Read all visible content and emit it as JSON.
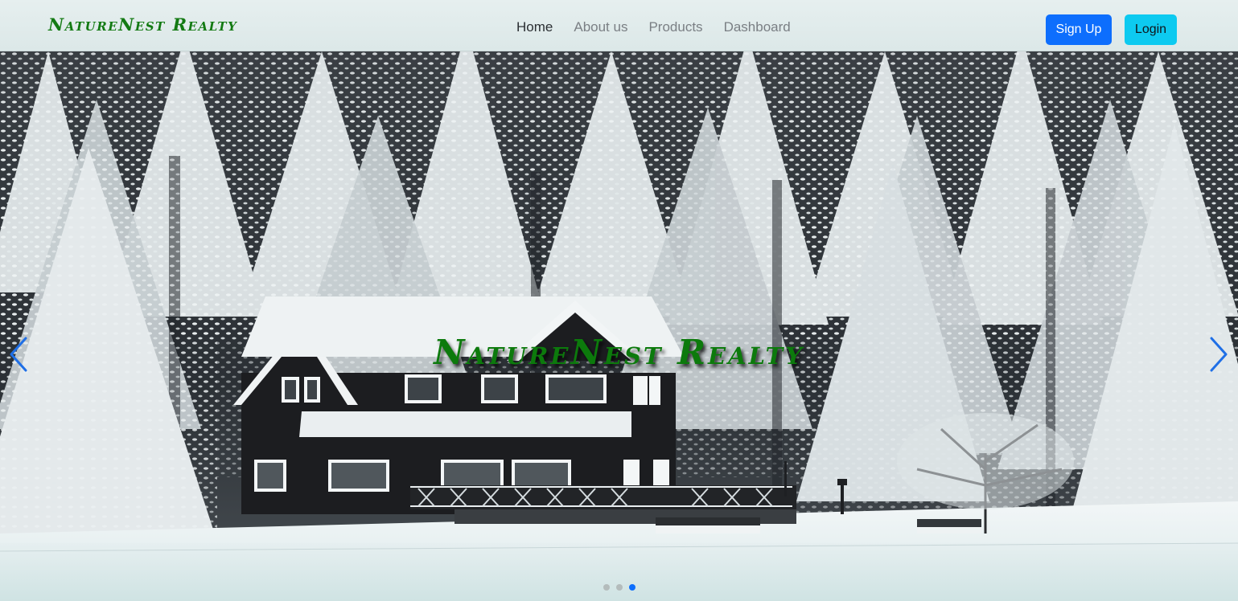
{
  "navbar": {
    "brand": "NatureNest Realty",
    "links": [
      {
        "label": "Home",
        "active": true
      },
      {
        "label": "About us",
        "active": false
      },
      {
        "label": "Products",
        "active": false
      },
      {
        "label": "Dashboard",
        "active": false
      }
    ],
    "signup_label": "Sign Up",
    "login_label": "Login"
  },
  "carousel": {
    "caption": "NatureNest Realty",
    "slide_count": 3,
    "active_slide": 3,
    "prev_icon": "chevron-left-icon",
    "next_icon": "chevron-right-icon"
  },
  "colors": {
    "brand_green": "#137a13",
    "primary": "#0d6efd",
    "info": "#0dcaf0"
  }
}
